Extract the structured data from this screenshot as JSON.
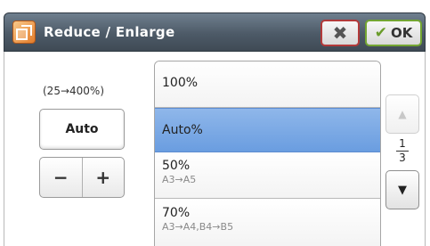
{
  "header": {
    "title": "Reduce / Enlarge",
    "close_label": "✖",
    "ok_label": "OK"
  },
  "left_panel": {
    "range_label": "(25→400%)",
    "value": "Auto",
    "minus_label": "−",
    "plus_label": "+"
  },
  "list": {
    "items": [
      {
        "label": "100%",
        "sub": ""
      },
      {
        "label": "Auto%",
        "sub": "",
        "selected": true
      },
      {
        "label": "50%",
        "sub": "A3→A5"
      },
      {
        "label": "70%",
        "sub": "A3→A4,B4→B5"
      }
    ]
  },
  "pager": {
    "current": "1",
    "total": "3"
  },
  "colors": {
    "selected": "#6a9de0",
    "close_border": "#b23a3a",
    "ok_border": "#73a532"
  }
}
